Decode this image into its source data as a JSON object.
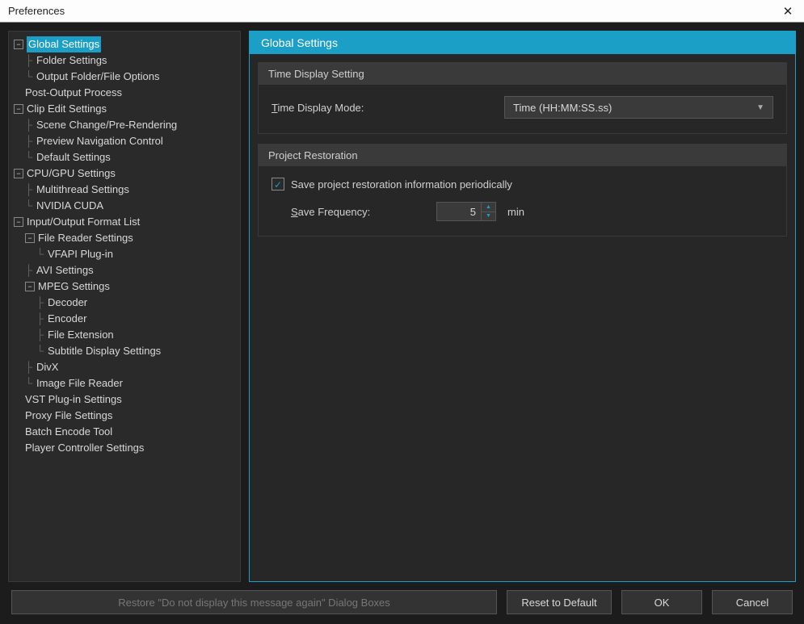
{
  "window": {
    "title": "Preferences"
  },
  "tree": {
    "global_settings": "Global Settings",
    "folder_settings": "Folder Settings",
    "output_folder_file_options": "Output Folder/File Options",
    "post_output_process": "Post-Output Process",
    "clip_edit_settings": "Clip Edit Settings",
    "scene_change_pre_rendering": "Scene Change/Pre-Rendering",
    "preview_navigation_control": "Preview Navigation Control",
    "default_settings": "Default Settings",
    "cpu_gpu_settings": "CPU/GPU Settings",
    "multithread_settings": "Multithread Settings",
    "nvidia_cuda": "NVIDIA CUDA",
    "input_output_format_list": "Input/Output Format List",
    "file_reader_settings": "File Reader Settings",
    "vfapi_plugin": "VFAPI Plug-in",
    "avi_settings": "AVI Settings",
    "mpeg_settings": "MPEG Settings",
    "decoder": "Decoder",
    "encoder": "Encoder",
    "file_extension": "File Extension",
    "subtitle_display_settings": "Subtitle Display Settings",
    "divx": "DivX",
    "image_file_reader": "Image File Reader",
    "vst_plugin_settings": "VST Plug-in Settings",
    "proxy_file_settings": "Proxy File Settings",
    "batch_encode_tool": "Batch Encode Tool",
    "player_controller_settings": "Player Controller Settings"
  },
  "content": {
    "header": "Global Settings",
    "time_display": {
      "group_title": "Time Display Setting",
      "label": "Time Display Mode:",
      "value": "Time (HH:MM:SS.ss)"
    },
    "project_restoration": {
      "group_title": "Project Restoration",
      "checkbox_label": "Save project restoration information periodically",
      "checked": true,
      "save_frequency_label": "Save Frequency:",
      "save_frequency_value": "5",
      "unit": "min"
    }
  },
  "footer": {
    "restore": "Restore \"Do not display this message again\" Dialog Boxes",
    "reset": "Reset to Default",
    "ok": "OK",
    "cancel": "Cancel"
  }
}
